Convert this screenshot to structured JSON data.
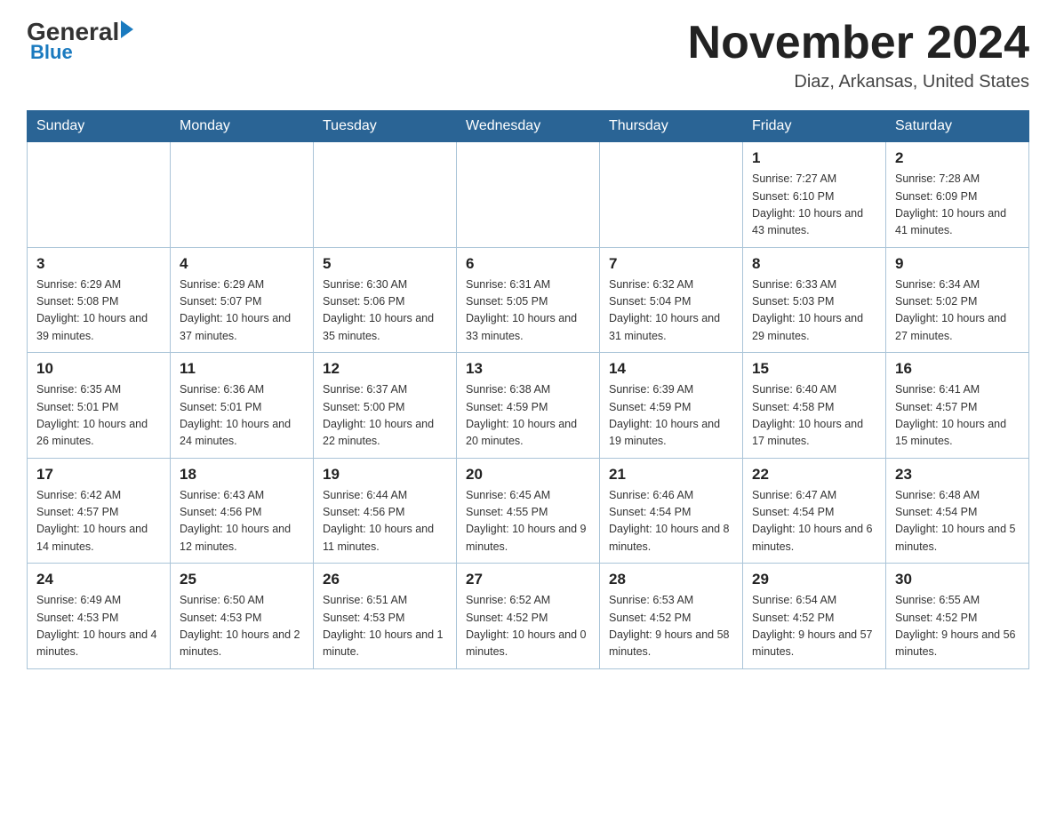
{
  "header": {
    "logo_general": "General",
    "logo_blue": "Blue",
    "month_title": "November 2024",
    "location": "Diaz, Arkansas, United States"
  },
  "weekdays": [
    "Sunday",
    "Monday",
    "Tuesday",
    "Wednesday",
    "Thursday",
    "Friday",
    "Saturday"
  ],
  "weeks": [
    [
      {
        "day": "",
        "info": ""
      },
      {
        "day": "",
        "info": ""
      },
      {
        "day": "",
        "info": ""
      },
      {
        "day": "",
        "info": ""
      },
      {
        "day": "",
        "info": ""
      },
      {
        "day": "1",
        "info": "Sunrise: 7:27 AM\nSunset: 6:10 PM\nDaylight: 10 hours and 43 minutes."
      },
      {
        "day": "2",
        "info": "Sunrise: 7:28 AM\nSunset: 6:09 PM\nDaylight: 10 hours and 41 minutes."
      }
    ],
    [
      {
        "day": "3",
        "info": "Sunrise: 6:29 AM\nSunset: 5:08 PM\nDaylight: 10 hours and 39 minutes."
      },
      {
        "day": "4",
        "info": "Sunrise: 6:29 AM\nSunset: 5:07 PM\nDaylight: 10 hours and 37 minutes."
      },
      {
        "day": "5",
        "info": "Sunrise: 6:30 AM\nSunset: 5:06 PM\nDaylight: 10 hours and 35 minutes."
      },
      {
        "day": "6",
        "info": "Sunrise: 6:31 AM\nSunset: 5:05 PM\nDaylight: 10 hours and 33 minutes."
      },
      {
        "day": "7",
        "info": "Sunrise: 6:32 AM\nSunset: 5:04 PM\nDaylight: 10 hours and 31 minutes."
      },
      {
        "day": "8",
        "info": "Sunrise: 6:33 AM\nSunset: 5:03 PM\nDaylight: 10 hours and 29 minutes."
      },
      {
        "day": "9",
        "info": "Sunrise: 6:34 AM\nSunset: 5:02 PM\nDaylight: 10 hours and 27 minutes."
      }
    ],
    [
      {
        "day": "10",
        "info": "Sunrise: 6:35 AM\nSunset: 5:01 PM\nDaylight: 10 hours and 26 minutes."
      },
      {
        "day": "11",
        "info": "Sunrise: 6:36 AM\nSunset: 5:01 PM\nDaylight: 10 hours and 24 minutes."
      },
      {
        "day": "12",
        "info": "Sunrise: 6:37 AM\nSunset: 5:00 PM\nDaylight: 10 hours and 22 minutes."
      },
      {
        "day": "13",
        "info": "Sunrise: 6:38 AM\nSunset: 4:59 PM\nDaylight: 10 hours and 20 minutes."
      },
      {
        "day": "14",
        "info": "Sunrise: 6:39 AM\nSunset: 4:59 PM\nDaylight: 10 hours and 19 minutes."
      },
      {
        "day": "15",
        "info": "Sunrise: 6:40 AM\nSunset: 4:58 PM\nDaylight: 10 hours and 17 minutes."
      },
      {
        "day": "16",
        "info": "Sunrise: 6:41 AM\nSunset: 4:57 PM\nDaylight: 10 hours and 15 minutes."
      }
    ],
    [
      {
        "day": "17",
        "info": "Sunrise: 6:42 AM\nSunset: 4:57 PM\nDaylight: 10 hours and 14 minutes."
      },
      {
        "day": "18",
        "info": "Sunrise: 6:43 AM\nSunset: 4:56 PM\nDaylight: 10 hours and 12 minutes."
      },
      {
        "day": "19",
        "info": "Sunrise: 6:44 AM\nSunset: 4:56 PM\nDaylight: 10 hours and 11 minutes."
      },
      {
        "day": "20",
        "info": "Sunrise: 6:45 AM\nSunset: 4:55 PM\nDaylight: 10 hours and 9 minutes."
      },
      {
        "day": "21",
        "info": "Sunrise: 6:46 AM\nSunset: 4:54 PM\nDaylight: 10 hours and 8 minutes."
      },
      {
        "day": "22",
        "info": "Sunrise: 6:47 AM\nSunset: 4:54 PM\nDaylight: 10 hours and 6 minutes."
      },
      {
        "day": "23",
        "info": "Sunrise: 6:48 AM\nSunset: 4:54 PM\nDaylight: 10 hours and 5 minutes."
      }
    ],
    [
      {
        "day": "24",
        "info": "Sunrise: 6:49 AM\nSunset: 4:53 PM\nDaylight: 10 hours and 4 minutes."
      },
      {
        "day": "25",
        "info": "Sunrise: 6:50 AM\nSunset: 4:53 PM\nDaylight: 10 hours and 2 minutes."
      },
      {
        "day": "26",
        "info": "Sunrise: 6:51 AM\nSunset: 4:53 PM\nDaylight: 10 hours and 1 minute."
      },
      {
        "day": "27",
        "info": "Sunrise: 6:52 AM\nSunset: 4:52 PM\nDaylight: 10 hours and 0 minutes."
      },
      {
        "day": "28",
        "info": "Sunrise: 6:53 AM\nSunset: 4:52 PM\nDaylight: 9 hours and 58 minutes."
      },
      {
        "day": "29",
        "info": "Sunrise: 6:54 AM\nSunset: 4:52 PM\nDaylight: 9 hours and 57 minutes."
      },
      {
        "day": "30",
        "info": "Sunrise: 6:55 AM\nSunset: 4:52 PM\nDaylight: 9 hours and 56 minutes."
      }
    ]
  ]
}
